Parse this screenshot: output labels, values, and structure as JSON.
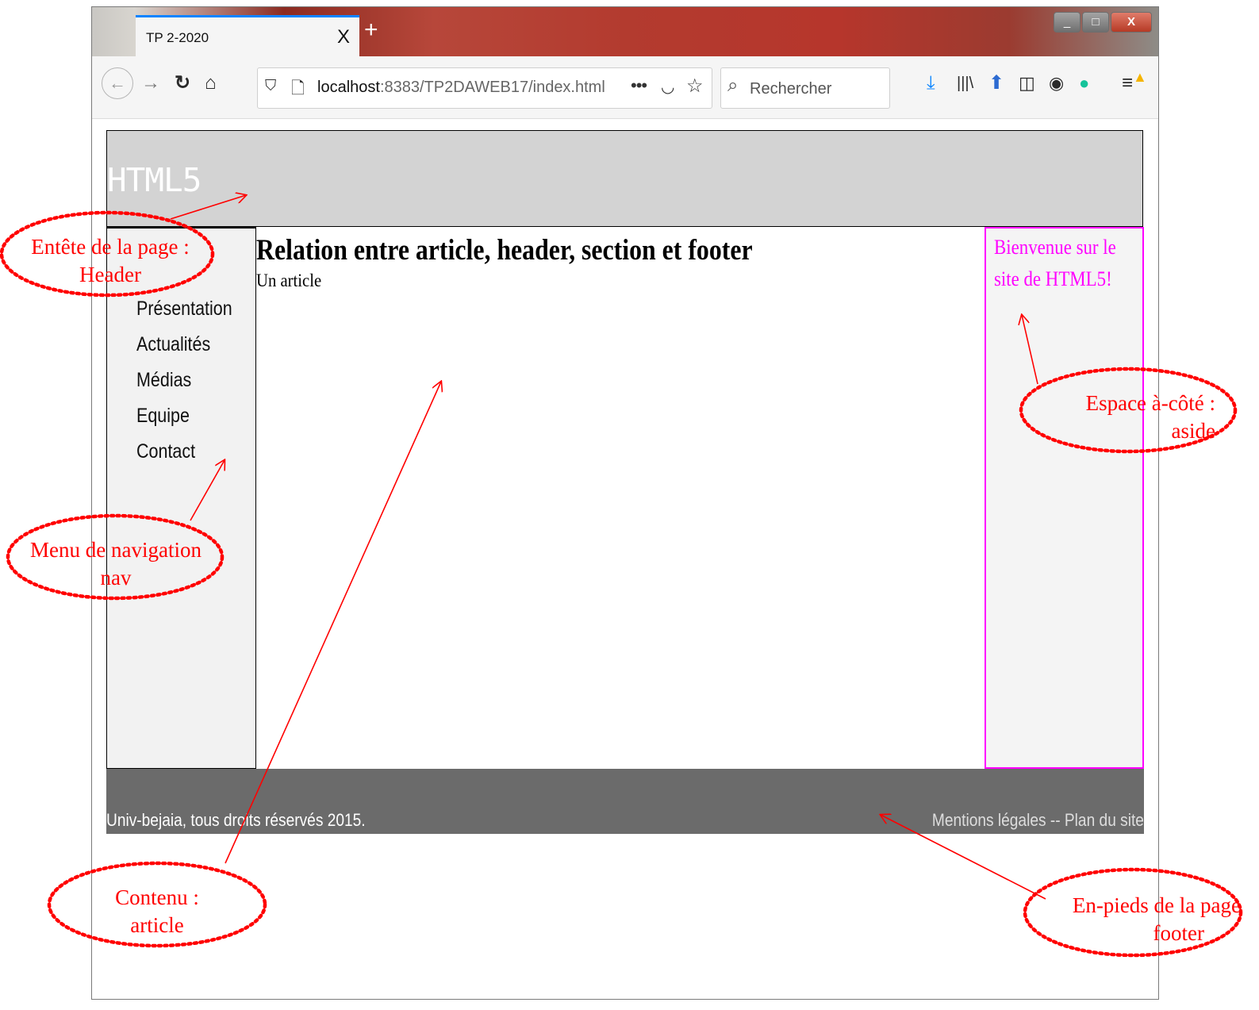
{
  "browser": {
    "tab_title": "TP 2-2020",
    "tab_close": "X",
    "new_tab": "+",
    "window_buttons": {
      "minimize": "_",
      "maximize": "□",
      "close": "X"
    },
    "url": {
      "host": "localhost",
      "rest": ":8383/TP2DAWEB17/index.html"
    },
    "search_placeholder": "Rechercher",
    "icons": [
      "back-icon",
      "forward-icon",
      "reload-icon",
      "home-icon",
      "shield-icon",
      "page-icon",
      "more-icon",
      "pocket-icon",
      "bookmark-star-icon",
      "search-icon",
      "download-icon",
      "library-icon",
      "extension-icon",
      "sidebar-icon",
      "account-icon",
      "grammarly-icon",
      "menu-icon"
    ]
  },
  "page": {
    "header_title": "HTML5",
    "nav_items": [
      "Présentation",
      "Actualités",
      "Médias",
      "Equipe",
      "Contact"
    ],
    "article_title": "Relation entre article, header, section et footer",
    "article_text": "Un article",
    "aside_text": "Bienvenue sur le site de HTML5!",
    "footer_left": "Univ-bejaia, tous droits réservés 2015.",
    "footer_right": "Mentions légales -- Plan du site"
  },
  "annotations": {
    "header": {
      "line1": "Entête de la page :",
      "line2": "Header"
    },
    "nav": {
      "line1": "Menu de navigation",
      "line2": "nav"
    },
    "aside": {
      "line1": "Espace à-côté :",
      "line2": "aside"
    },
    "article": {
      "line1": "Contenu :",
      "line2": "article"
    },
    "footer": {
      "line1": "En-pieds de la page",
      "line2": "footer"
    }
  },
  "colors": {
    "header_bg": "#d3d3d3",
    "nav_bg": "#f2f2f2",
    "aside_border": "#ff00ff",
    "footer_bg": "#6b6b6b",
    "annotation": "#ff0000",
    "tab_accent": "#0a84ff"
  }
}
